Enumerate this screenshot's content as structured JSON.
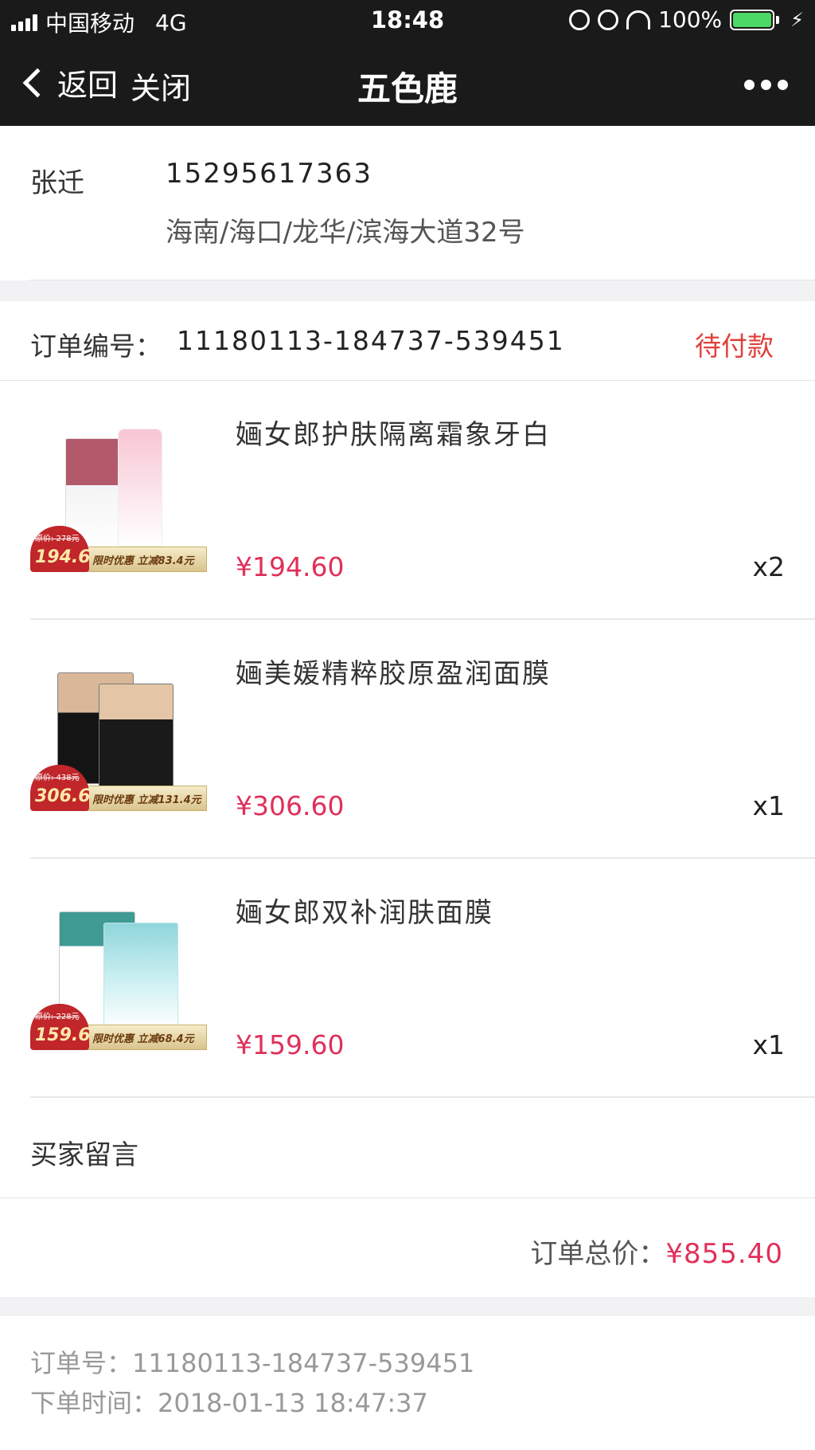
{
  "status_bar": {
    "carrier": "中国移动",
    "network": "4G",
    "time": "18:48",
    "battery": "100%"
  },
  "nav": {
    "back_label": "返回",
    "close_label": "关闭",
    "title": "五色鹿"
  },
  "address": {
    "name": "张迁",
    "phone": "15295617363",
    "detail": "海南/海口/龙华/滨海大道32号"
  },
  "order": {
    "number_label": "订单编号：",
    "number": "11180113-184737-539451",
    "status": "待付款"
  },
  "products": [
    {
      "title": "婳女郎护肤隔离霜象牙白",
      "price": "¥194.60",
      "qty": "x2",
      "badge_orig": "原价: 278元",
      "badge_price": "194.6",
      "badge_text": "限时优惠 立减83.4元"
    },
    {
      "title": "婳美媛精粹胶原盈润面膜",
      "price": "¥306.60",
      "qty": "x1",
      "badge_orig": "原价: 438元",
      "badge_price": "306.6",
      "badge_text": "限时优惠 立减131.4元"
    },
    {
      "title": "婳女郎双补润肤面膜",
      "price": "¥159.60",
      "qty": "x1",
      "badge_orig": "原价: 228元",
      "badge_price": "159.6",
      "badge_text": "限时优惠 立减68.4元"
    }
  ],
  "message": {
    "label": "买家留言"
  },
  "total": {
    "label": "订单总价：",
    "value": "¥855.40"
  },
  "info": {
    "order_no": "订单号：11180113-184737-539451",
    "order_time": "下单时间：2018-01-13 18:47:37"
  }
}
